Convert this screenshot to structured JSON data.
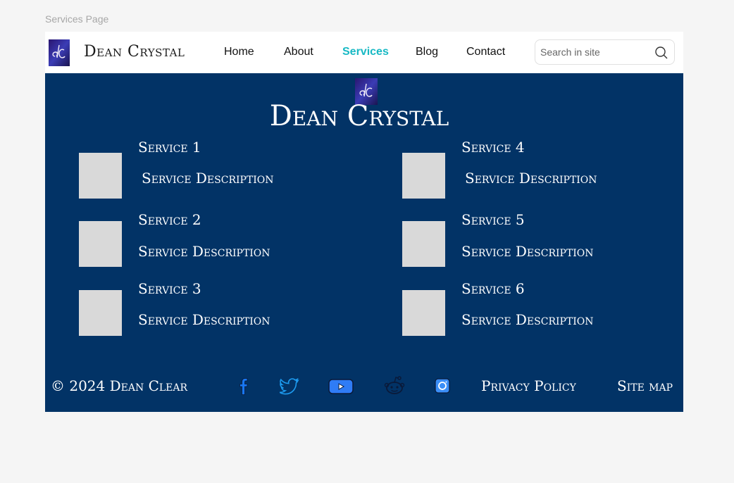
{
  "frame_label": "Services Page",
  "header": {
    "brand": "Dean Crystal",
    "nav": [
      "Home",
      "About",
      "Services",
      "Blog",
      "Contact"
    ],
    "active_nav": "Services",
    "search_placeholder": "Search in site"
  },
  "hero": {
    "title": "Dean Crystal"
  },
  "services": [
    {
      "name": "Service 1",
      "description": "Service Description"
    },
    {
      "name": "Service 2",
      "description": "Service Description"
    },
    {
      "name": "Service 3",
      "description": "Service Description"
    },
    {
      "name": "Service 4",
      "description": "Service Description"
    },
    {
      "name": "Service 5",
      "description": "Service Description"
    },
    {
      "name": "Service 6",
      "description": "Service Description"
    }
  ],
  "footer": {
    "copyright": "© 2024 Dean Clear",
    "social_icons": [
      "facebook-icon",
      "twitter-icon",
      "youtube-icon",
      "reddit-icon",
      "instagram-icon"
    ],
    "links": [
      "Privacy Policy",
      "Site map"
    ]
  },
  "colors": {
    "main_bg": "#023366",
    "accent": "#18b9c4",
    "placeholder_box": "#d9d9d9"
  }
}
